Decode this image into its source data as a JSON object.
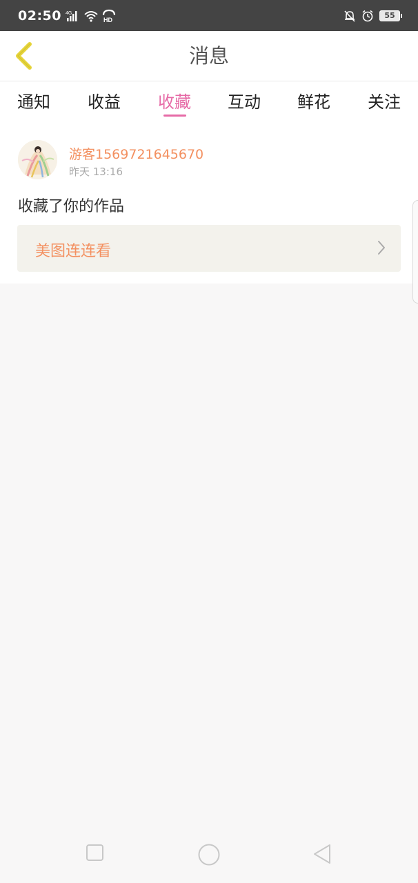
{
  "status_bar": {
    "time": "02:50",
    "network": "4G",
    "hd": "HD",
    "battery": "55",
    "icons": [
      "signal-icon",
      "wifi-icon",
      "hd-call-icon",
      "mute-bell-icon",
      "alarm-icon",
      "battery-icon"
    ]
  },
  "header": {
    "title": "消息",
    "back_icon": "chevron-left-icon",
    "accent_color": "#e6d43a"
  },
  "tabs": [
    {
      "label": "通知",
      "active": false
    },
    {
      "label": "收益",
      "active": false
    },
    {
      "label": "收藏",
      "active": true
    },
    {
      "label": "互动",
      "active": false
    },
    {
      "label": "鲜花",
      "active": false
    },
    {
      "label": "关注",
      "active": false
    }
  ],
  "active_color": "#e66aa6",
  "messages": [
    {
      "username": "游客1569721645670",
      "time": "昨天 13:16",
      "text": "收藏了你的作品",
      "link_label": "美图连连看",
      "link_icon": "chevron-right-icon"
    }
  ],
  "system_nav": {
    "icons": [
      "recent-apps-icon",
      "home-icon",
      "back-triangle-icon"
    ]
  }
}
